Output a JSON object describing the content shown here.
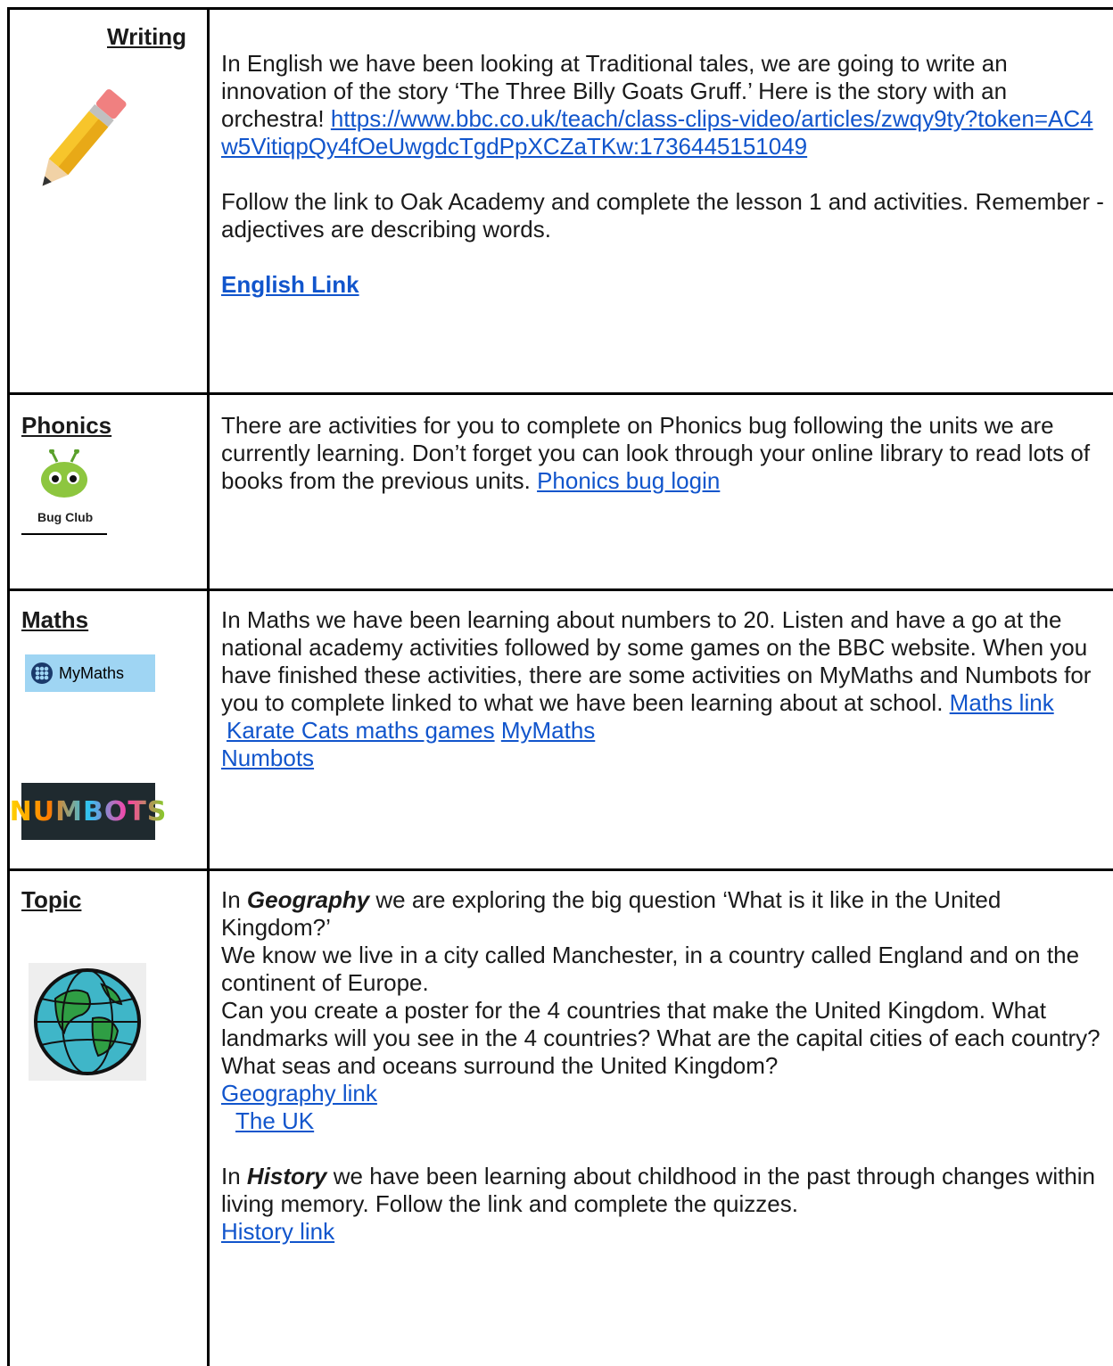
{
  "rows": [
    {
      "label": "Writing",
      "paragraphs": {
        "p1_text": "In English we have been looking at Traditional tales, we are going to write an innovation of the story ‘The Three Billy Goats Gruff.’ Here is the story with an orchestra!",
        "p1_link": "https://www.bbc.co.uk/teach/class-clips-video/articles/zwqy9ty?token=AC4w5VitiqpQy4fOeUwgdcTgdPpXCZaTKw:1736445151049",
        "p2_text": "Follow the link to Oak Academy and complete the lesson 1 and activities. Remember - adjectives are describing words.",
        "p3_link": "English Link"
      },
      "icon": "pencil-icon"
    },
    {
      "label": "Phonics",
      "text": "There are activities for you to complete on Phonics bug following the units we are currently learning. Don’t forget you can look through your online library to read lots of books from the previous units.",
      "link": "Phonics bug login",
      "logo_text": "Bug Club",
      "icon": "bug-club-logo"
    },
    {
      "label": "Maths",
      "text": "In Maths we have been learning about numbers to 20. Listen and have a go at the national academy activities followed by some games on the BBC website. When you have finished these activities, there are some activities on MyMaths and Numbots for you to complete linked to what we have been learning about at school.",
      "links": [
        "Maths link ",
        "Karate Cats maths games",
        "MyMaths",
        "Numbots"
      ],
      "mymaths_logo": "MyMaths",
      "numbots_logo": "NUMBOTS"
    },
    {
      "label": "Topic",
      "geo_intro": "In",
      "geo_subject": "Geography",
      "geo_q": "we are exploring the big question ‘What is it like in the United Kingdom?’",
      "geo_line2": "We know we live in a city called Manchester, in a country called England and on the continent of Europe.",
      "geo_line3": "Can you create a poster for the 4 countries that make the United Kingdom. What landmarks will you see in the 4 countries? What are the capital cities of each country? What seas and oceans surround the United Kingdom?",
      "geo_link": "Geography link",
      "uk_link": "The UK",
      "hist_intro": "In",
      "hist_subject": "History",
      "hist_text": "we have been learning about childhood in the past through changes within living memory. Follow the link and complete the quizzes.",
      "hist_link": "History link",
      "icon": "globe-icon"
    }
  ]
}
